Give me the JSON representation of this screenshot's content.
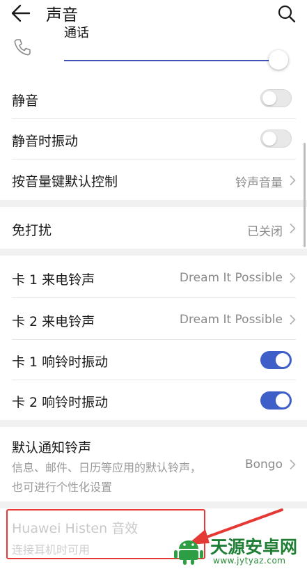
{
  "header": {
    "title": "声音"
  },
  "volume": {
    "label": "通话",
    "level": 1.0
  },
  "settings": {
    "mute": {
      "label": "静音",
      "enabled": false
    },
    "mute_vibrate": {
      "label": "静音时振动",
      "enabled": false
    },
    "volume_key": {
      "label": "按音量键默认控制",
      "value": "铃声音量"
    },
    "dnd": {
      "label": "免打扰",
      "value": "已关闭"
    },
    "sim1_ringtone": {
      "label": "卡 1 来电铃声",
      "value": "Dream It Possible"
    },
    "sim2_ringtone": {
      "label": "卡 2 来电铃声",
      "value": "Dream It Possible"
    },
    "sim1_vibrate": {
      "label": "卡 1 响铃时振动",
      "enabled": true
    },
    "sim2_vibrate": {
      "label": "卡 2 响铃时振动",
      "enabled": true
    },
    "notification": {
      "label": "默认通知铃声",
      "desc_line1": "信息、邮件、日历等应用的默认铃声，",
      "desc_line2": "也可进行个性化设置",
      "value": "Bongo"
    },
    "histen": {
      "label": "Huawei Histen 音效",
      "desc": "连接耳机时可用"
    }
  },
  "watermark": {
    "name": "天源安卓网",
    "url": "www.jytyaz.com"
  },
  "colors": {
    "accent": "#3e5fc7",
    "highlight": "#e53935",
    "watermark": "#1e7e34"
  }
}
